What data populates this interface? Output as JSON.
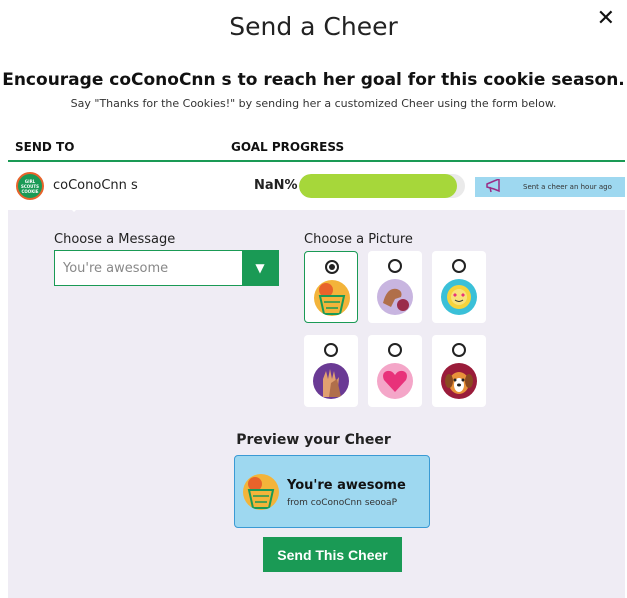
{
  "modal": {
    "title": "Send a Cheer",
    "close_label": "✕"
  },
  "headline": "Encourage coConoCnn s to reach her goal for this cookie season.",
  "subline": "Say \"Thanks for the Cookies!\" by sending her a customized Cheer using the form below.",
  "table": {
    "headers": {
      "send_to": "SEND TO",
      "goal_progress": "GOAL PROGRESS"
    },
    "row": {
      "avatar_text": "GIRL SCOUTS COOKIE",
      "name": "coConoCnn s",
      "percent": "NaN%",
      "progress_fraction": 0.95,
      "sent_text": "Sent a cheer an hour ago"
    }
  },
  "form": {
    "message_label": "Choose a Message",
    "message_value": "You're awesome",
    "picture_label": "Choose a Picture",
    "pictures": [
      {
        "icon": "basketball-hoop",
        "selected": true
      },
      {
        "icon": "flexing-arm",
        "selected": false
      },
      {
        "icon": "sun-heart-eyes",
        "selected": false
      },
      {
        "icon": "high-five-hand",
        "selected": false
      },
      {
        "icon": "heart",
        "selected": false
      },
      {
        "icon": "dog",
        "selected": false
      }
    ]
  },
  "preview": {
    "title": "Preview your Cheer",
    "message": "You're awesome",
    "from": "from coConoCnn seooaP"
  },
  "send_button": "Send This Cheer",
  "colors": {
    "brand_green": "#1a9a55",
    "progress_green": "#a6d73a",
    "light_blue": "#9ed8f0",
    "panel_lavender": "#efecf4"
  }
}
